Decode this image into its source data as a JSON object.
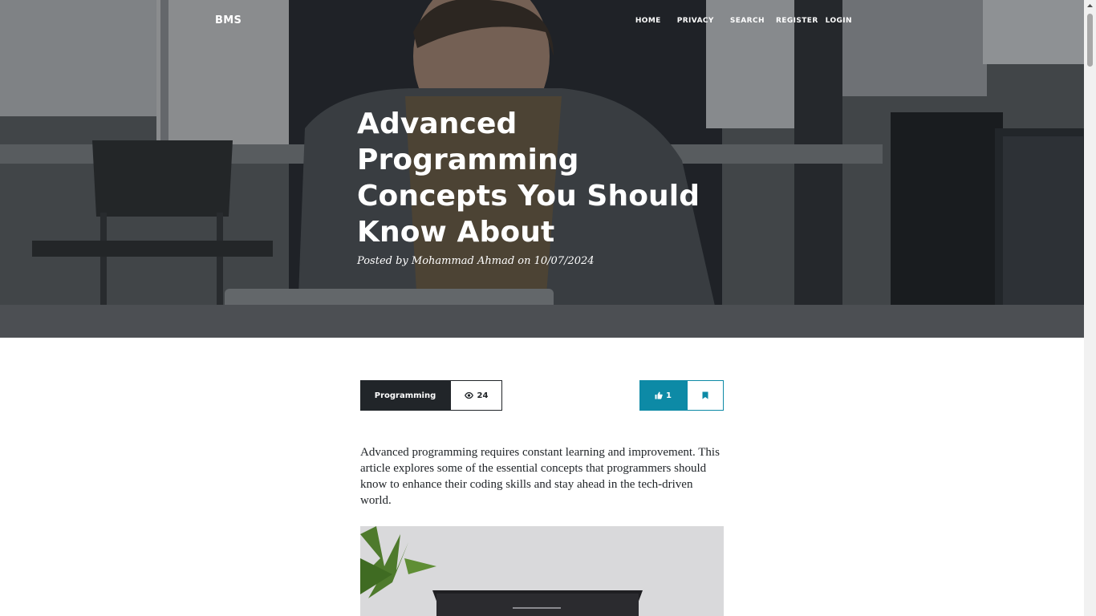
{
  "nav": {
    "brand": "BMS",
    "links": [
      "HOME",
      "PRIVACY",
      "SEARCH",
      "REGISTER",
      "LOGIN"
    ]
  },
  "post": {
    "title": "Advanced Programming Concepts You Should Know About",
    "meta": "Posted by Mohammad Ahmad on 10/07/2024",
    "category": "Programming",
    "views": "24",
    "likes": "1",
    "body": "Advanced programming requires constant learning and improvement. This article explores some of the essential concepts that programmers should know to enhance their coding skills and stay ahead in the tech-driven world."
  },
  "icons": {
    "views": "eye-icon",
    "like": "thumbs-up-icon",
    "bookmark": "bookmark-icon"
  },
  "colors": {
    "accent": "#0d8aa6",
    "dark": "#212529"
  }
}
